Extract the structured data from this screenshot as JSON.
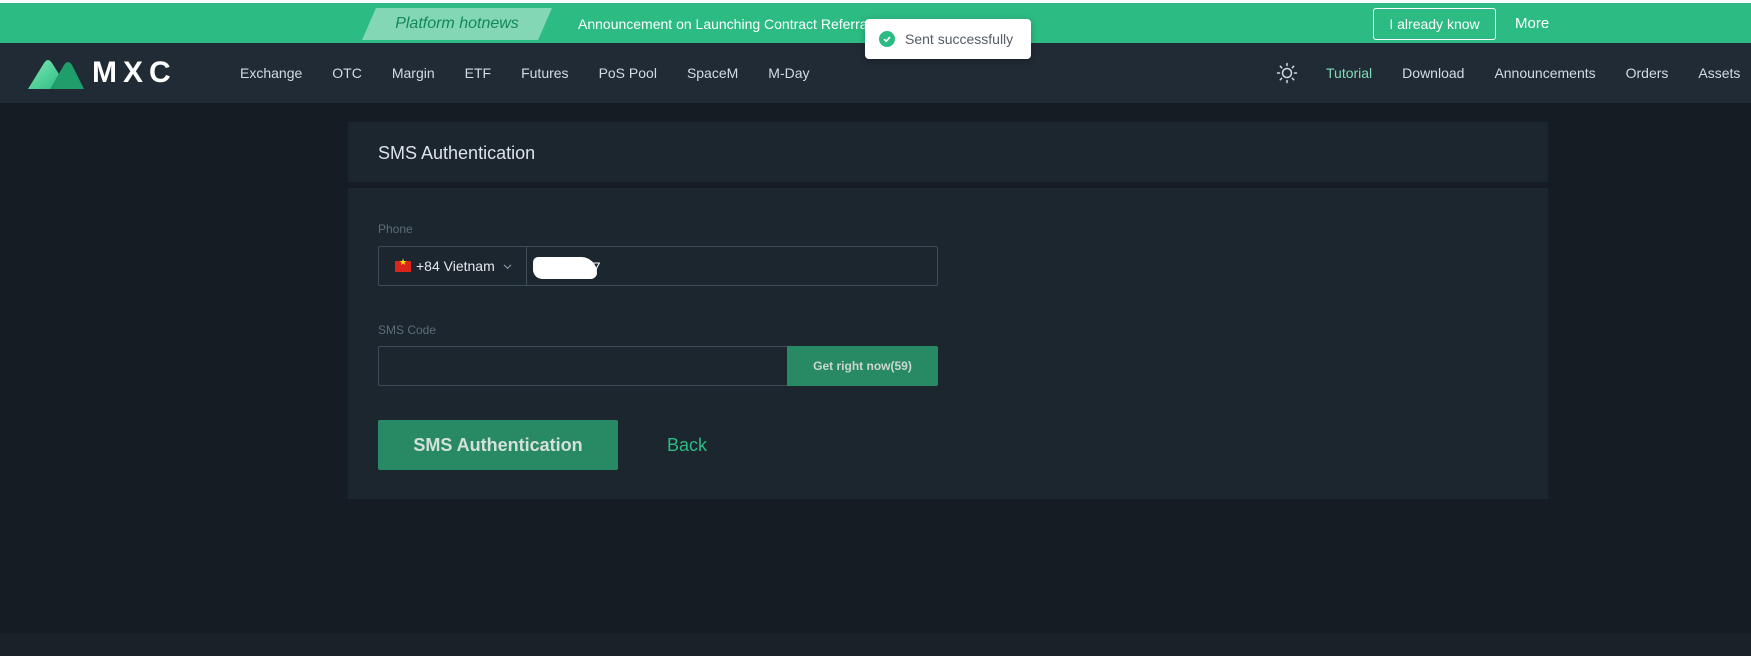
{
  "banner": {
    "tag": "Platform hotnews",
    "announcement": "Announcement on Launching Contract Referral",
    "dismiss_label": "I already know",
    "more_label": "More"
  },
  "toast": {
    "text": "Sent successfully",
    "icon": "check-circle-icon"
  },
  "nav": {
    "brand": "MXC",
    "left_items": [
      "Exchange",
      "OTC",
      "Margin",
      "ETF",
      "Futures",
      "PoS Pool",
      "SpaceM",
      "M-Day"
    ],
    "right_items": [
      "Tutorial",
      "Download",
      "Announcements",
      "Orders",
      "Assets"
    ],
    "theme_icon": "sun-icon"
  },
  "form": {
    "title": "SMS Authentication",
    "phone_label": "Phone",
    "country": "+84 Vietnam",
    "phone_value_visible": "67",
    "sms_label": "SMS Code",
    "sms_value": "",
    "get_code_label": "Get right now(59)",
    "submit_label": "SMS Authentication",
    "back_label": "Back"
  },
  "colors": {
    "accent": "#2cbc83",
    "button": "#288a64",
    "background": "#151c23",
    "panel": "#1c262f",
    "nav": "#212b35"
  }
}
